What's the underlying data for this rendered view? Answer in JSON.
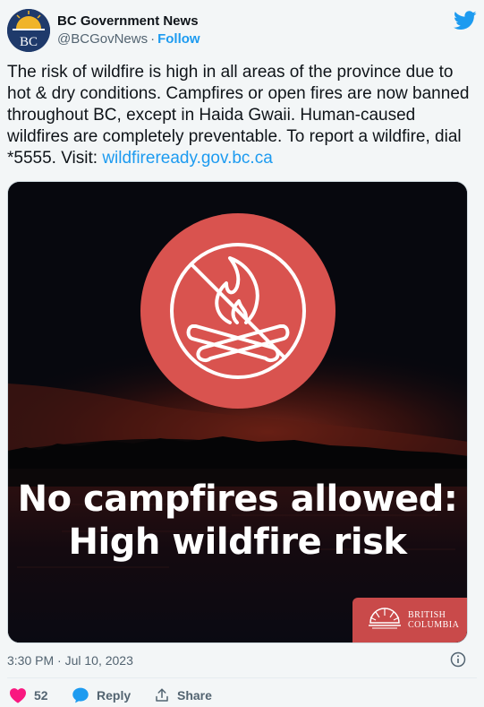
{
  "account": {
    "display_name": "BC Government News",
    "handle": "@BCGovNews",
    "separator": "·",
    "follow_label": "Follow",
    "avatar_letters": "BC"
  },
  "tweet": {
    "text": "The risk of wildfire is high in all areas of the province due to hot & dry conditions. Campfires or open fires are now banned throughout BC, except in Haida Gwaii. Human-caused wildfires are completely preventable. To report a wildfire, dial *5555. Visit: ",
    "link_text": "wildfireready.gov.bc.ca",
    "timestamp": "3:30 PM · Jul 10, 2023"
  },
  "media": {
    "headline_line1": "No campfires allowed:",
    "headline_line2": "High wildfire risk",
    "logo_line1": "BRITISH",
    "logo_line2": "COLUMBIA"
  },
  "actions": {
    "like_count": "52",
    "reply_label": "Reply",
    "share_label": "Share"
  },
  "colors": {
    "accent": "#1d9bf0",
    "like": "#f91880",
    "badge": "#d9534f",
    "logo_bg": "#c94a4a"
  },
  "icons": [
    "twitter-bird-icon",
    "no-campfire-icon",
    "info-icon",
    "heart-icon",
    "reply-bubble-icon",
    "share-icon"
  ]
}
